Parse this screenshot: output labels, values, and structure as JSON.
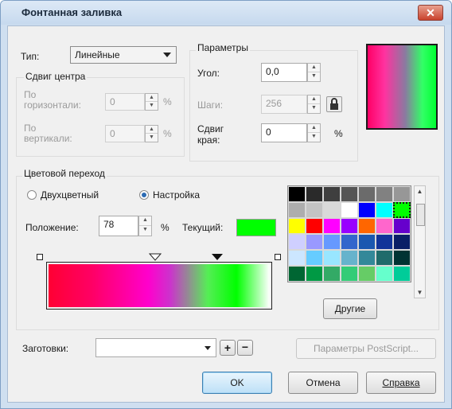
{
  "window": {
    "title": "Фонтанная заливка",
    "close_label": "✕"
  },
  "type_field": {
    "label": "Тип:",
    "value": "Линейные"
  },
  "center_offset": {
    "title": "Сдвиг центра",
    "horizontal_label_1": "По",
    "horizontal_label_2": "горизонтали:",
    "horizontal_value": "0",
    "vertical_label_1": "По",
    "vertical_label_2": "вертикали:",
    "vertical_value": "0",
    "unit": "%"
  },
  "params": {
    "title": "Параметры",
    "angle_label": "Угол:",
    "angle_value": "0,0",
    "steps_label": "Шаги:",
    "steps_value": "256",
    "edge_label_1": "Сдвиг",
    "edge_label_2": "края:",
    "edge_value": "0",
    "unit": "%"
  },
  "blend": {
    "title": "Цветовой переход",
    "two_color_label": "Двухцветный",
    "custom_label": "Настройка",
    "selected": "custom",
    "position_label": "Положение:",
    "position_value": "78",
    "unit": "%",
    "current_label": "Текущий:",
    "current_color": "#00ff00"
  },
  "palette": {
    "colors": [
      "#000000",
      "#2a2a2a",
      "#3f3f3f",
      "#555555",
      "#6b6b6b",
      "#818181",
      "#979797",
      "#adadad",
      "#c3c3c3",
      "#d9d9d9",
      "#ffffff",
      "#0000ff",
      "#00ffff",
      "#00ff00",
      "#ffff00",
      "#ff0000",
      "#ff00ff",
      "#9900ff",
      "#ff6600",
      "#ff66cc",
      "#6600cc",
      "#cfcfff",
      "#9999ff",
      "#6699ff",
      "#3366cc",
      "#1a57b0",
      "#113399",
      "#0a1f66",
      "#cce6ff",
      "#66ccff",
      "#99e6ff",
      "#66b3cc",
      "#338899",
      "#1f6b6b",
      "#003333",
      "#006633",
      "#009944",
      "#33aa66",
      "#33cc77",
      "#66cc66",
      "#66ffcc",
      "#00cc99"
    ],
    "selected_index": 13,
    "others_button": "Другие"
  },
  "presets": {
    "label": "Заготовки:",
    "value": ""
  },
  "postscript_button": "Параметры PostScript...",
  "ok_button": "OK",
  "cancel_button": "Отмена",
  "help_button": "Справка",
  "gradient_markers": {
    "position_percent": 78,
    "midpoint_percent": 50
  }
}
